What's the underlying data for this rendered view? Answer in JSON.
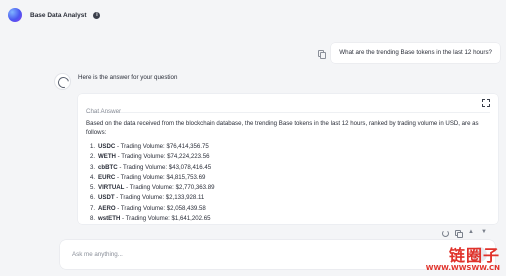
{
  "app": {
    "title": "Base Data Analyst",
    "icons": {
      "logo": "gradient-orb-logo",
      "info": "info-icon"
    }
  },
  "user_message": {
    "text": "What are the trending Base tokens in the last 12 hours?",
    "icon": "copy-icon"
  },
  "bot": {
    "intro": "Here is the answer for your question",
    "avatar_icon": "spinner-avatar-icon"
  },
  "answer_card": {
    "title": "Chat Answer",
    "expand_icon": "expand-icon",
    "summary": "Based on the data received from the blockchain database, the trending Base tokens in the last 12 hours, ranked by trading volume in USD, are as follows:",
    "volume_label": " - Trading Volume: ",
    "tokens": [
      {
        "num": "1.",
        "symbol": "USDC",
        "volume": "$76,414,356.75"
      },
      {
        "num": "2.",
        "symbol": "WETH",
        "volume": "$74,224,223.56"
      },
      {
        "num": "3.",
        "symbol": "cbBTC",
        "volume": "$43,078,416.45"
      },
      {
        "num": "4.",
        "symbol": "EURC",
        "volume": "$4,815,753.69"
      },
      {
        "num": "5.",
        "symbol": "VIRTUAL",
        "volume": "$2,770,363.89"
      },
      {
        "num": "6.",
        "symbol": "USDT",
        "volume": "$2,133,928.11"
      },
      {
        "num": "7.",
        "symbol": "AERO",
        "volume": "$2,058,439.58"
      },
      {
        "num": "8.",
        "symbol": "wstETH",
        "volume": "$1,641,202.65"
      }
    ]
  },
  "actions": [
    "refresh-icon",
    "copy-icon",
    "thumbs-up-icon",
    "thumbs-down-icon"
  ],
  "input": {
    "placeholder": "Ask me anything...",
    "value": "",
    "send_icon": "send-arrow-icon"
  },
  "watermark": {
    "line1": "链圈子",
    "line2": "WWW.WWSWW.CN"
  },
  "colors": {
    "background": "#f4f5f7",
    "card": "#ffffff",
    "muted_text": "#8a8f99",
    "watermark": "#e0322b"
  }
}
